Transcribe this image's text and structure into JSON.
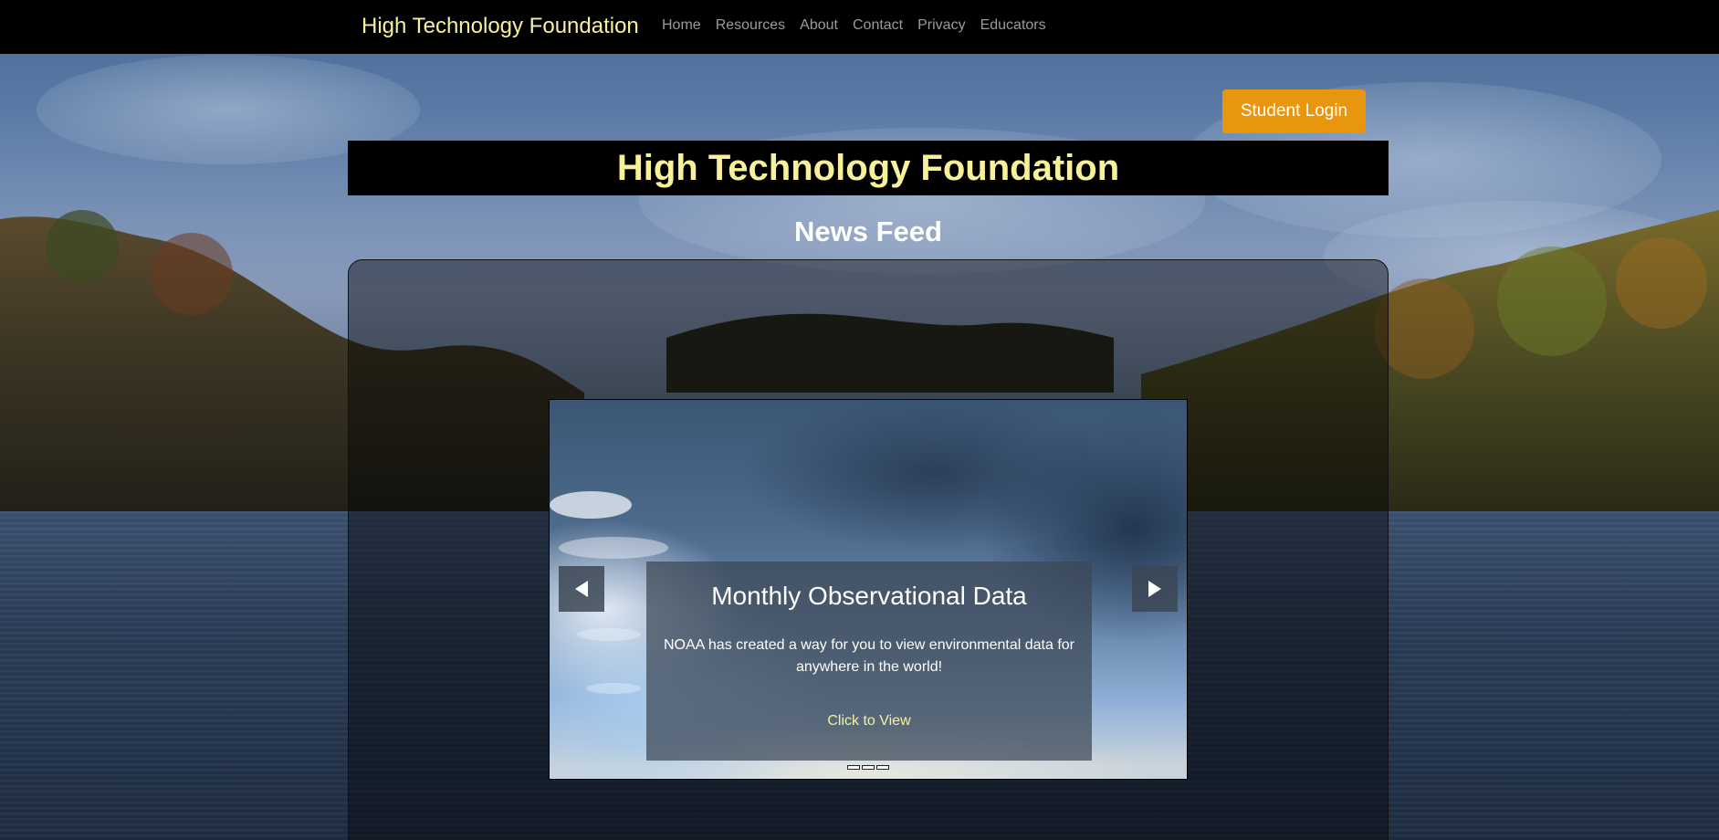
{
  "navbar": {
    "brand": "High Technology Foundation",
    "links": [
      {
        "label": "Home"
      },
      {
        "label": "Resources"
      },
      {
        "label": "About"
      },
      {
        "label": "Contact"
      },
      {
        "label": "Privacy"
      },
      {
        "label": "Educators"
      }
    ]
  },
  "login": {
    "label": "Student Login"
  },
  "banner": {
    "title": "High Technology Foundation"
  },
  "news": {
    "heading": "News Feed",
    "slide": {
      "title": "Monthly Observational Data",
      "body": "NOAA has created a way for you to view environmental data for anywhere in the world!",
      "link": "Click to View"
    },
    "indicator_count": 3,
    "active_indicator": 1
  },
  "colors": {
    "navbar_bg": "#000000",
    "brand_text": "#f8f19a",
    "nav_link": "#9a9a9a",
    "login_bg": "#e9960f",
    "banner_bg": "#000000"
  },
  "icons": {
    "prev": "triangle-left-icon",
    "next": "triangle-right-icon"
  }
}
